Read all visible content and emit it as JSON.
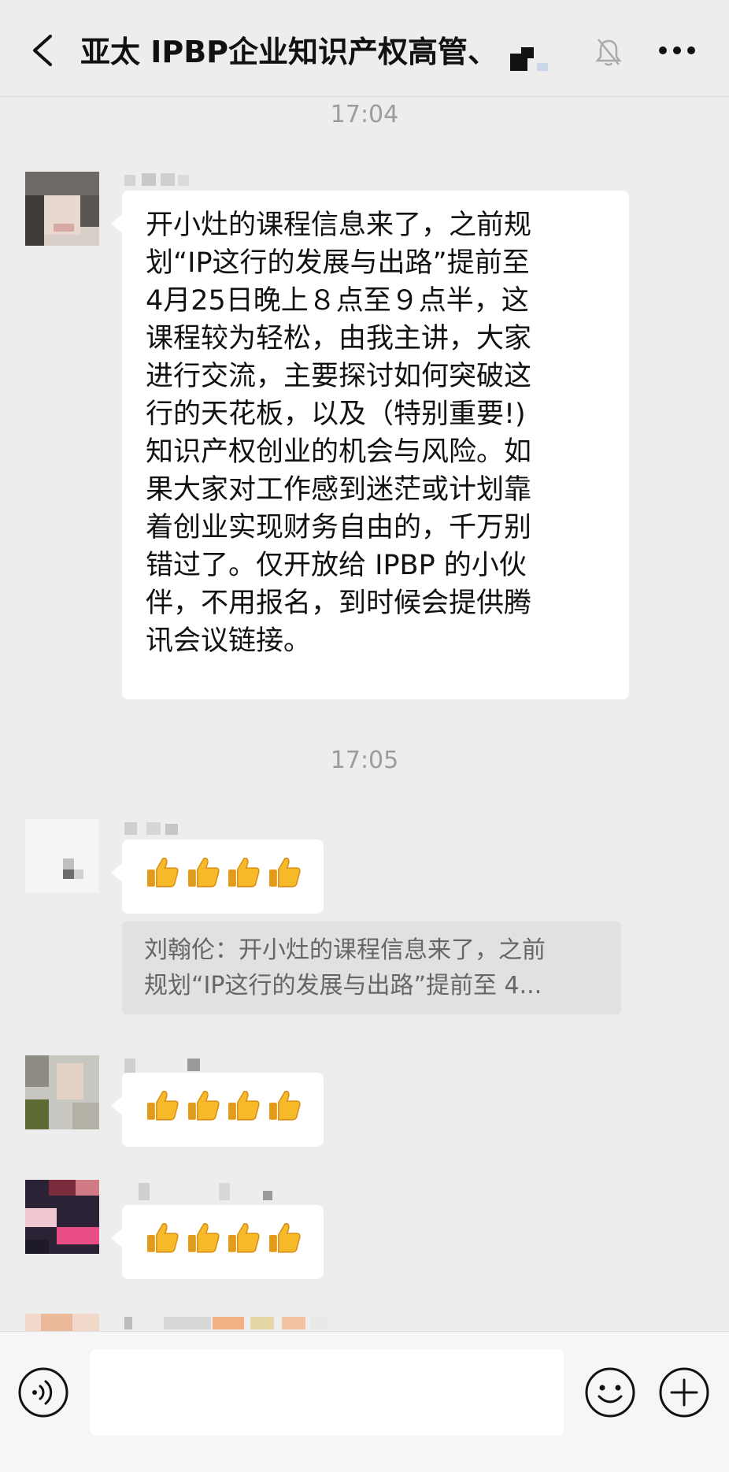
{
  "header": {
    "title": "亚太 IPBP企业知识产权高管、",
    "icons": [
      "back-icon",
      "mute-icon",
      "more-icon"
    ]
  },
  "timestamps": [
    "17:04",
    "17:05"
  ],
  "messages": [
    {
      "type": "text",
      "text": "开小灶的课程信息来了，之前规划“IP这行的发展与出路”提前至4月25日晚上８点至９点半，这课程较为轻松，由我主讲，大家进行交流，主要探讨如何突破这行的天花板，以及（特别重要!）知识产权创业的机会与风险。如果大家对工作感到迷茫或计划靠着创业实现财务自由的，千万别错过了。仅开放给 IPBP 的小伙伴，不用报名，到时候会提供腾讯会议链接。",
      "lines": [
        "开小灶的课程信息来了，之前规",
        "划“IP这行的发展与出路”提前至",
        "4月25日晚上８点至９点半，这",
        "课程较为轻松，由我主讲，大家",
        "进行交流，主要探讨如何突破这",
        "行的天花板，以及（特别重要!)",
        "知识产权创业的机会与风险。如",
        "果大家对工作感到迷茫或计划靠",
        "着创业实现财务自由的，千万别",
        "错过了。仅开放给 IPBP 的小伙",
        "伴，不用报名，到时候会提供腾",
        "讯会议链接。"
      ]
    },
    {
      "type": "emoji",
      "emoji": "👍👍👍👍",
      "quote_lines": [
        "刘翰伦：开小灶的课程信息来了，之前",
        "规划“IP这行的发展与出路”提前至 4..."
      ]
    },
    {
      "type": "emoji",
      "emoji": "👍👍👍👍"
    },
    {
      "type": "emoji",
      "emoji": "👍👍👍👍"
    }
  ],
  "input": {
    "placeholder": "",
    "icons": [
      "voice-icon",
      "emoji-icon",
      "plus-icon"
    ]
  },
  "colors": {
    "background": "#ededed",
    "bubble": "#ffffff",
    "quote": "#e1e1e1",
    "timestamp": "#9c9c9c"
  }
}
